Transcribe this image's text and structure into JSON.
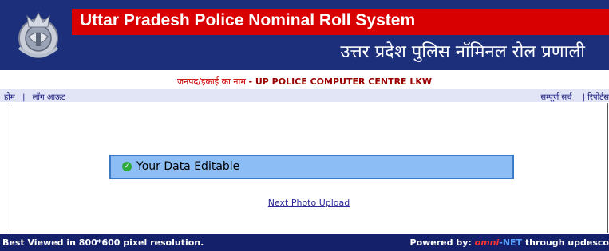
{
  "header": {
    "title_en": "Uttar Pradesh Police Nominal Roll System",
    "title_hi": "उत्तर प्रदेश पुलिस नॉमिनल रोल प्रणाली",
    "logo_icon": "up-police-emblem-icon"
  },
  "district": {
    "label": "जनपद/इकाई का नाम",
    "value": "- UP POLICE COMPUTER CENTRE LKW"
  },
  "nav": {
    "home": "होम",
    "separator": "|",
    "logout": "लॉग आऊट",
    "full_search": "सम्पूर्ण सर्च",
    "reports": "| रिपोर्टस"
  },
  "message": {
    "text": "Your Data Editable",
    "icon": "check-circle-icon"
  },
  "link": {
    "next": "Next Photo Upload"
  },
  "footer": {
    "left": "Best Viewed in 800*600 pixel resolution.",
    "powered_by": "Powered by:",
    "brand_omni": "omni",
    "brand_net": "-NET",
    "tail": " through updesco"
  },
  "colors": {
    "header_red": "#d80000",
    "header_blue": "#1c2f7a",
    "footer_blue": "#14206a",
    "message_bg": "#8cbef5",
    "message_border": "#3a7ac8"
  }
}
